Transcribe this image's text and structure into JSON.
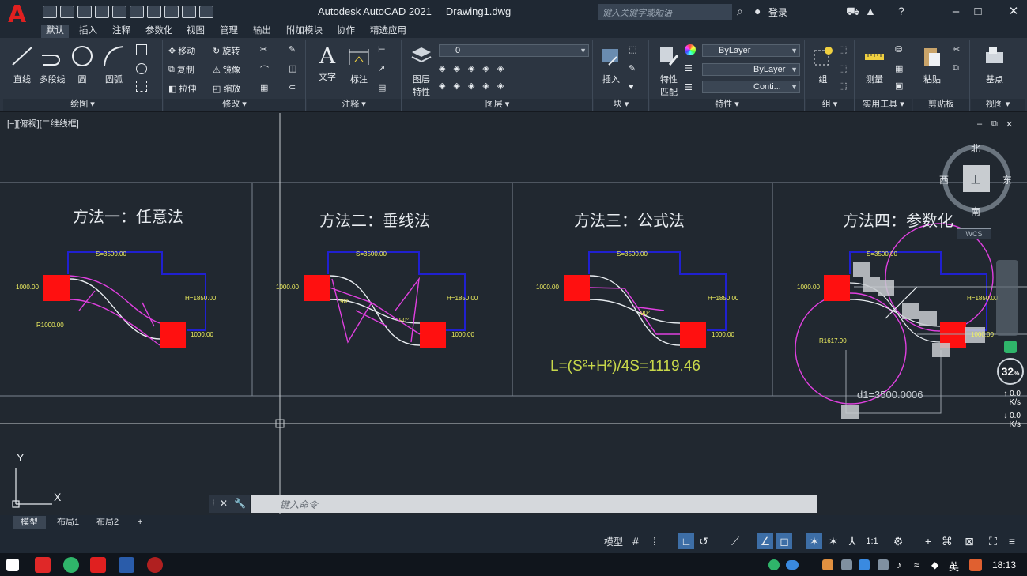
{
  "titlebar": {
    "app_title": "Autodesk AutoCAD 2021",
    "file_name": "Drawing1.dwg",
    "search_placeholder": "键入关键字或短语",
    "login_label": "登录"
  },
  "ribbon_tabs": [
    "默认",
    "插入",
    "注释",
    "参数化",
    "视图",
    "管理",
    "输出",
    "附加模块",
    "协作",
    "精选应用"
  ],
  "ribbon": {
    "draw": {
      "title": "绘图",
      "line": "直线",
      "polyline": "多段线",
      "circle": "圆",
      "arc": "圆弧"
    },
    "modify": {
      "title": "修改",
      "move": "移动",
      "rotate": "旋转",
      "copy": "复制",
      "mirror": "镜像",
      "stretch": "拉伸",
      "scale": "缩放"
    },
    "annotation": {
      "title": "注释",
      "text": "文字",
      "dimension": "标注"
    },
    "layers": {
      "title": "图层",
      "layer_props_1": "图层",
      "layer_props_2": "特性",
      "current_layer": "0"
    },
    "block": {
      "title": "块",
      "insert": "插入"
    },
    "properties": {
      "title": "特性",
      "match_1": "特性",
      "match_2": "匹配",
      "color": "ByLayer",
      "linetype": "ByLayer",
      "lineweight": "Conti..."
    },
    "groups": {
      "title": "组",
      "group": "组"
    },
    "utilities": {
      "title": "实用工具",
      "measure": "测量"
    },
    "clipboard": {
      "title": "剪贴板",
      "paste": "粘贴"
    },
    "view": {
      "title": "视图",
      "base": "基点"
    }
  },
  "viewport": {
    "label": "[−][俯视][二维线框]",
    "methods": [
      "方法一：任意法",
      "方法二：垂线法",
      "方法三：公式法",
      "方法四：参数化"
    ],
    "dims": {
      "s": "S=3500.00",
      "h": "H=1850.00",
      "w": "1000.00",
      "r1": "R1000.00",
      "r4": "R1617.90",
      "angle": "90°"
    },
    "formula": "L=(S²+H²)/4S=1119.46",
    "compass": {
      "north": "北",
      "south": "南",
      "east": "东",
      "west": "西",
      "top": "上"
    },
    "wcs": "WCS",
    "dynamic_input": "d1=3500.0006",
    "ucs": {
      "x": "X",
      "y": "Y"
    }
  },
  "overlay": {
    "percent": "32",
    "percent_unit": "%",
    "upload": "0.0",
    "download": "0.0",
    "unit": "K/s"
  },
  "cmdline": {
    "placeholder": "键入命令"
  },
  "layout_tabs": [
    "模型",
    "布局1",
    "布局2"
  ],
  "statusbar": {
    "model": "模型",
    "scale": "1:1"
  },
  "taskbar": {
    "lang": "英",
    "time": "18:13"
  },
  "colors": {
    "background": "#212830",
    "magenta": "#e040e0",
    "blue": "#2020d0",
    "red": "#ff1010",
    "yellow": "#f0f060",
    "formula": "#c8d84a"
  }
}
